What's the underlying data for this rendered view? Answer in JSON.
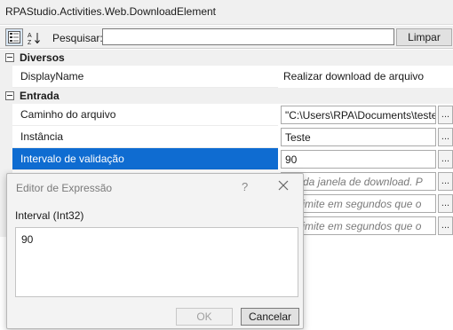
{
  "window": {
    "title": "RPAStudio.Activities.Web.DownloadElement"
  },
  "toolbar": {
    "categorized_icon": "categorized-grid-icon",
    "alpha_sort_icon": "sort-az-icon",
    "search_label": "Pesquisar:",
    "search_value": "",
    "clear_label": "Limpar"
  },
  "grid": {
    "categories": [
      {
        "name": "Diversos",
        "properties": [
          {
            "name": "DisplayName",
            "value": "Realizar download de arquivo"
          }
        ]
      },
      {
        "name": "Entrada",
        "properties": [
          {
            "name": "Caminho do arquivo",
            "value": "\"C:\\Users\\RPA\\Documents\\teste"
          },
          {
            "name": "Instância",
            "value": "Teste"
          },
          {
            "name": "Intervalo de validação",
            "value": "90"
          },
          {
            "name": "",
            "value": "me da janela de download. P"
          },
          {
            "name": "",
            "value": "po limite em segundos que o"
          },
          {
            "name": "",
            "value": "po limite em segundos que o"
          }
        ]
      }
    ],
    "ellipsis_label": "...",
    "selected_color": "#0f6cd1"
  },
  "dialog": {
    "title": "Editor de Expressão",
    "help_label": "?",
    "close_icon": "close-icon",
    "field_label": "Interval (Int32)",
    "expression": "90",
    "ok_label": "OK",
    "cancel_label": "Cancelar"
  }
}
